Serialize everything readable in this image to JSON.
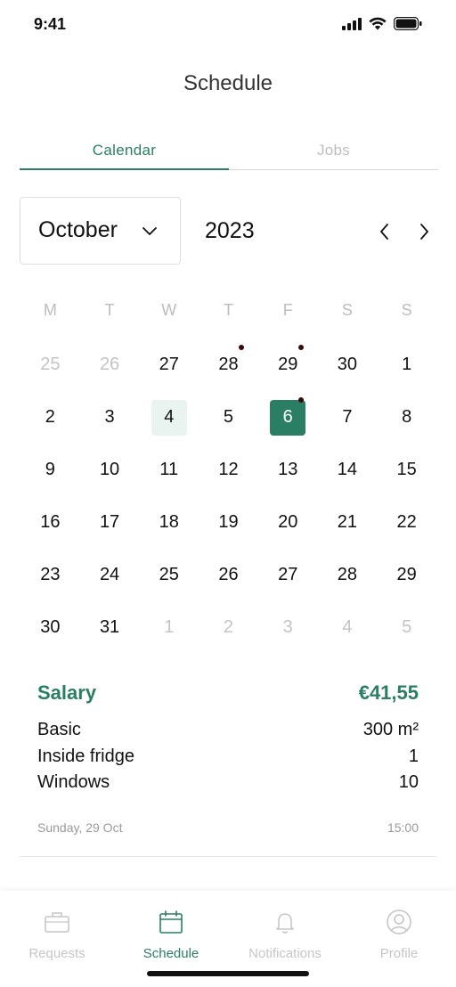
{
  "status_bar": {
    "time": "9:41"
  },
  "header": {
    "title": "Schedule"
  },
  "tabs": [
    {
      "label": "Calendar",
      "active": true
    },
    {
      "label": "Jobs",
      "active": false
    }
  ],
  "calendar": {
    "month": "October",
    "year": "2023",
    "weekdays": [
      "M",
      "T",
      "W",
      "T",
      "F",
      "S",
      "S"
    ],
    "weeks": [
      [
        {
          "d": "25",
          "muted": true
        },
        {
          "d": "26",
          "muted": true
        },
        {
          "d": "27"
        },
        {
          "d": "28",
          "dot": true
        },
        {
          "d": "29",
          "dot": true
        },
        {
          "d": "30"
        },
        {
          "d": "1"
        }
      ],
      [
        {
          "d": "2"
        },
        {
          "d": "3"
        },
        {
          "d": "4",
          "today": true
        },
        {
          "d": "5"
        },
        {
          "d": "6",
          "selected": true,
          "dot": true
        },
        {
          "d": "7"
        },
        {
          "d": "8"
        }
      ],
      [
        {
          "d": "9"
        },
        {
          "d": "10"
        },
        {
          "d": "11"
        },
        {
          "d": "12"
        },
        {
          "d": "13"
        },
        {
          "d": "14"
        },
        {
          "d": "15"
        }
      ],
      [
        {
          "d": "16"
        },
        {
          "d": "17"
        },
        {
          "d": "18"
        },
        {
          "d": "19"
        },
        {
          "d": "20"
        },
        {
          "d": "21"
        },
        {
          "d": "22"
        }
      ],
      [
        {
          "d": "23"
        },
        {
          "d": "24"
        },
        {
          "d": "25"
        },
        {
          "d": "26"
        },
        {
          "d": "27"
        },
        {
          "d": "28"
        },
        {
          "d": "29"
        }
      ],
      [
        {
          "d": "30"
        },
        {
          "d": "31"
        },
        {
          "d": "1",
          "muted": true
        },
        {
          "d": "2",
          "muted": true
        },
        {
          "d": "3",
          "muted": true
        },
        {
          "d": "4",
          "muted": true
        },
        {
          "d": "5",
          "muted": true
        }
      ]
    ]
  },
  "job": {
    "salary_label": "Salary",
    "salary_value": "€41,55",
    "items": [
      {
        "name": "Basic",
        "value": "300 m²"
      },
      {
        "name": "Inside fridge",
        "value": "1"
      },
      {
        "name": "Windows",
        "value": "10"
      }
    ],
    "date": "Sunday, 29 Oct",
    "time": "15:00"
  },
  "bottom_nav": [
    {
      "label": "Requests",
      "icon": "briefcase-icon",
      "active": false
    },
    {
      "label": "Schedule",
      "icon": "calendar-icon",
      "active": true
    },
    {
      "label": "Notifications",
      "icon": "bell-icon",
      "active": false
    },
    {
      "label": "Profile",
      "icon": "user-icon",
      "active": false
    }
  ],
  "colors": {
    "accent": "#2a7e63",
    "today_bg": "#e9f3ef",
    "event_dot": "#3a0a0a",
    "muted": "#c4c4c4"
  }
}
